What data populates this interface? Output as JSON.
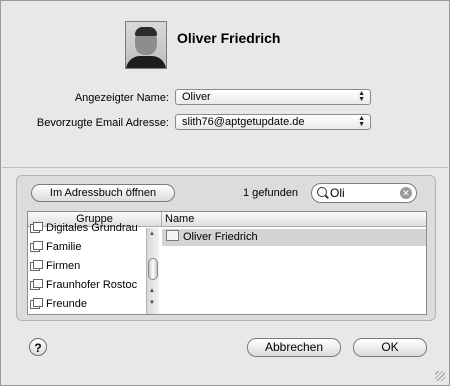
{
  "contact": {
    "name": "Oliver Friedrich"
  },
  "fields": {
    "display_name_label": "Angezeigter Name:",
    "display_name_value": "Oliver",
    "email_label": "Bevorzugte Email Adresse:",
    "email_value": "slith76@aptgetupdate.de"
  },
  "picker": {
    "open_addressbook_label": "Im Adressbuch öffnen",
    "found_text": "1 gefunden",
    "search_value": "Oli",
    "group_header": "Gruppe",
    "name_header": "Name",
    "groups": [
      "Digitales Grundrau",
      "Familie",
      "Firmen",
      "Fraunhofer Rostoc",
      "Freunde"
    ],
    "results": [
      "Oliver Friedrich"
    ]
  },
  "footer": {
    "help_label": "?",
    "cancel_label": "Abbrechen",
    "ok_label": "OK"
  },
  "colors": {
    "selection": "#d4d4d4",
    "panel": "#e8e8e8"
  }
}
